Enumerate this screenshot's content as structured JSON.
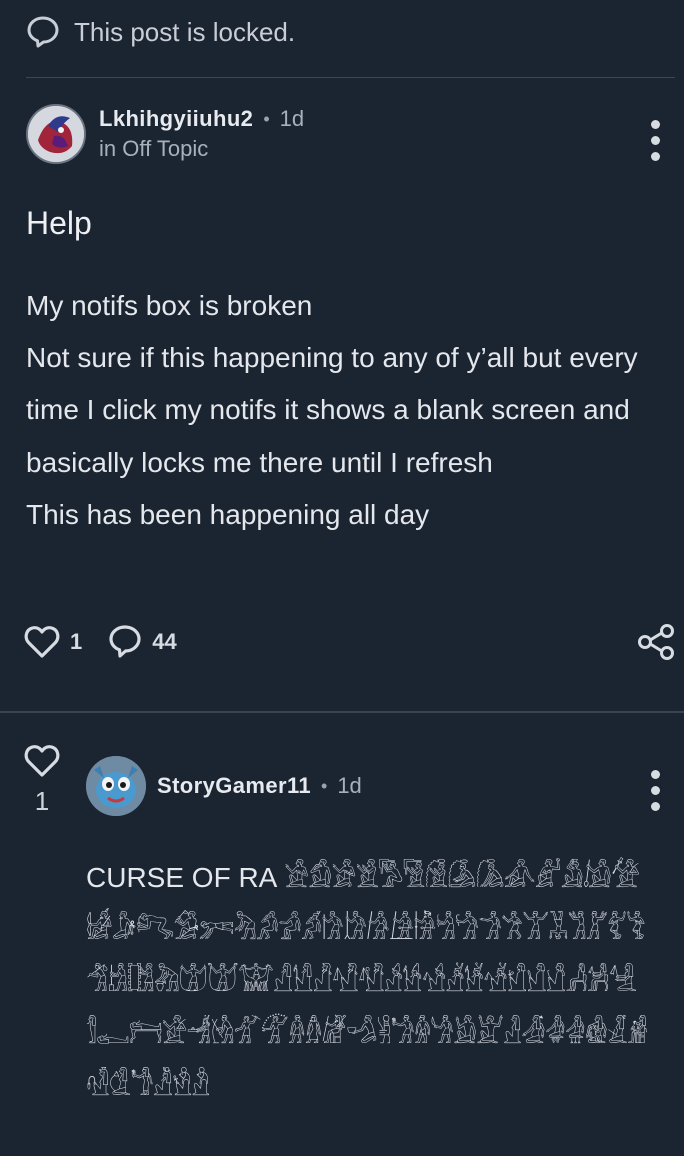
{
  "locked_notice": "This post is locked.",
  "post": {
    "username": "Lkhihgyiiuhu2",
    "time": "1d",
    "category": "in Off Topic",
    "title": "Help",
    "body": [
      "My notifs box is broken",
      "Not sure if this happening to any of y’all but every time I click my notifs it shows a blank screen and basically locks me there until I refresh",
      "This has been happening all day"
    ],
    "likes": "1",
    "comments": "44"
  },
  "reply": {
    "votes": "1",
    "username": "StoryGamer11",
    "time": "1d",
    "lead": "CURSE OF RA",
    "glyphs": "𓀀𓀁𓀂𓀃𓀄𓀅𓀆𓀇𓀈𓀉𓀊𓀋𓀌𓀍𓀎𓀏𓀐𓀑𓀒𓀓𓀔𓀕𓀖𓀗𓀘𓀙𓀚𓀛𓀜𓀝𓀞𓀟𓀠𓀡𓀢𓀣𓀤𓀥𓀦𓀧𓀨𓀩𓀪𓀫𓀬𓀭𓀮𓀯𓀰𓀱𓀲𓀳𓀴𓀵𓀶𓀷𓀸𓀹𓀺𓀻𓀼𓀽𓀾𓀿𓁀𓁁𓁂𓁃𓁄𓁅𓁆𓁇𓁈𓁉𓁊𓁋𓁌𓁍𓁎𓁏𓁐𓁑𓁒𓁓𓁔𓁕𓁖𓁗𓁘𓁙𓁚𓁛𓁜"
  },
  "icons": {
    "locked": "speech-bubble-icon",
    "like": "heart-icon",
    "comment": "speech-bubble-icon",
    "share": "share-icon",
    "more": "kebab-icon"
  },
  "colors": {
    "background": "#1b2431",
    "text": "#e4e7ec",
    "muted": "#a8b0bb",
    "divider": "#3b4656"
  }
}
